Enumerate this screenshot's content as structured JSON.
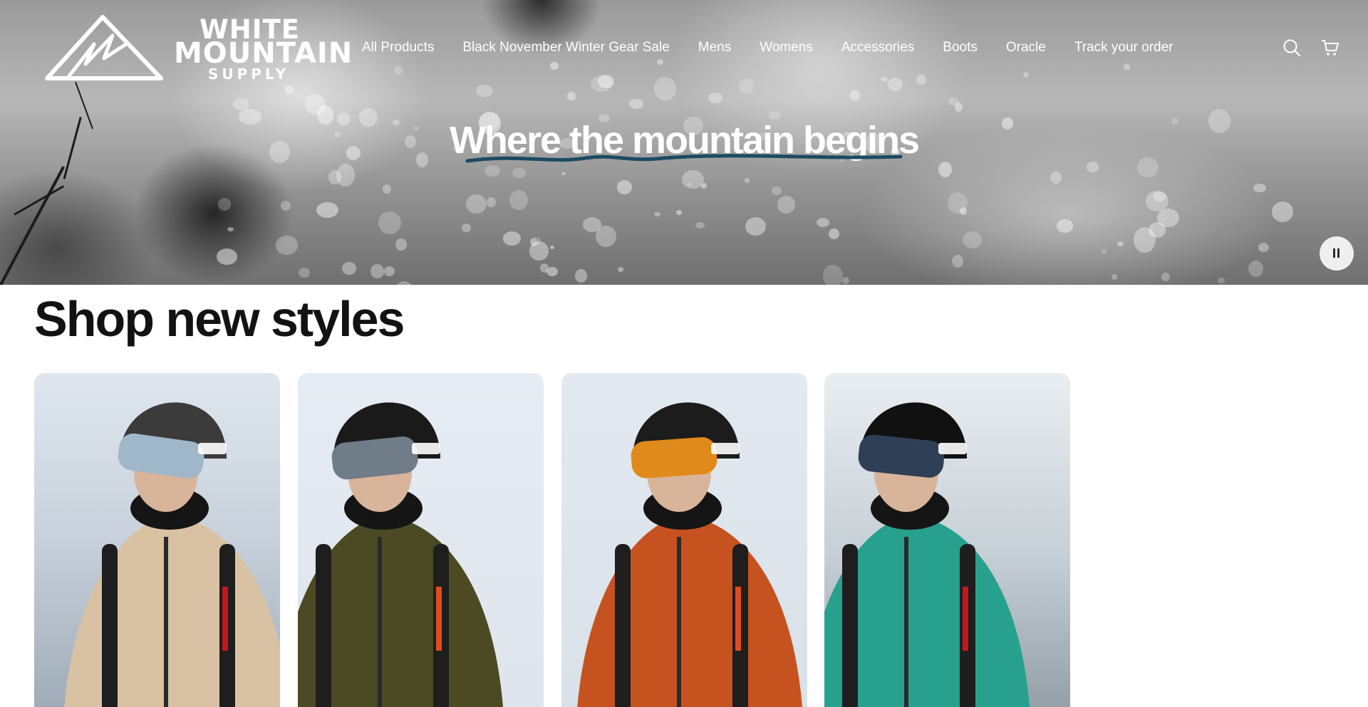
{
  "header": {
    "logo": {
      "line1": "WHITE",
      "line2": "MOUNTAIN",
      "line3": "SUPPLY"
    },
    "nav": [
      {
        "label": "All Products"
      },
      {
        "label": "Black November Winter Gear Sale"
      },
      {
        "label": "Mens"
      },
      {
        "label": "Womens"
      },
      {
        "label": "Accessories"
      },
      {
        "label": "Boots"
      },
      {
        "label": "Oracle"
      },
      {
        "label": "Track your order"
      }
    ],
    "icons": [
      "search-icon",
      "cart-icon"
    ]
  },
  "hero": {
    "title": "Where the mountain begins",
    "controls": {
      "pause_label": "II",
      "pause_icon": "pause-icon"
    },
    "underline_color": "#1d4a63"
  },
  "section": {
    "title": "Shop new styles",
    "cards": [
      {
        "jacket_color": "#d9c2a3",
        "helmet_color": "#3b3b3b",
        "goggle_color": "#9fb7c9",
        "accent": "#c4161c"
      },
      {
        "jacket_color": "#4c4a22",
        "helmet_color": "#1a1a1a",
        "goggle_color": "#707c88",
        "accent": "#e24b1c"
      },
      {
        "jacket_color": "#c65220",
        "helmet_color": "#1c1c1c",
        "goggle_color": "#e08a1c",
        "accent": "#e24b1c"
      },
      {
        "jacket_color": "#27a08e",
        "helmet_color": "#111111",
        "goggle_color": "#2f3f55",
        "accent": "#c4161c"
      }
    ]
  }
}
